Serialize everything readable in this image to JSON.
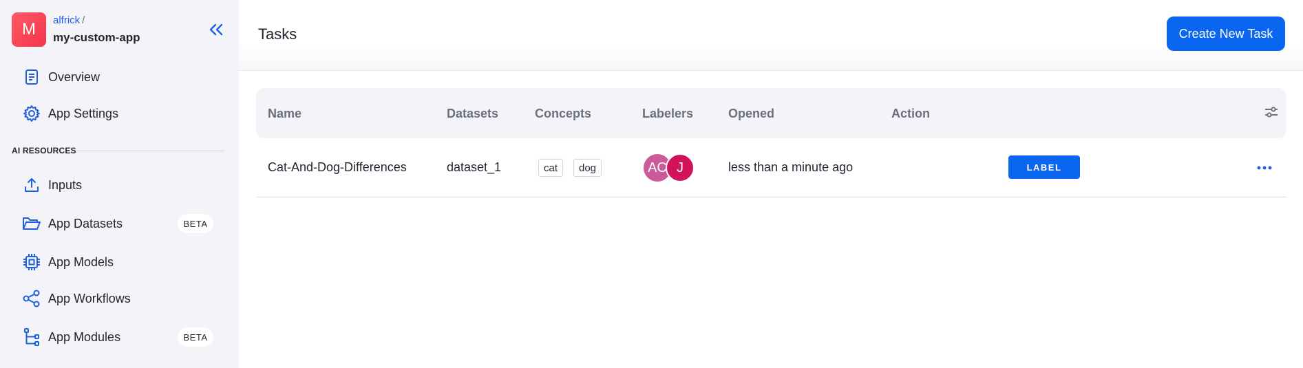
{
  "sidebar": {
    "app_avatar_letter": "M",
    "owner": "alfrick",
    "separator": "/",
    "app_name": "my-custom-app",
    "collapse_icon": "double-chevron-left-icon",
    "section_label": "AI RESOURCES",
    "items": [
      {
        "label": "Overview",
        "icon": "document-icon"
      },
      {
        "label": "App Settings",
        "icon": "gear-icon"
      },
      {
        "label": "Inputs",
        "icon": "upload-icon"
      },
      {
        "label": "App Datasets",
        "icon": "folder-open-icon",
        "badge": "BETA"
      },
      {
        "label": "App Models",
        "icon": "chip-icon"
      },
      {
        "label": "App Workflows",
        "icon": "share-nodes-icon"
      },
      {
        "label": "App Modules",
        "icon": "tree-branch-icon",
        "badge": "BETA"
      }
    ]
  },
  "header": {
    "title": "Tasks",
    "create_button": "Create New Task"
  },
  "table": {
    "columns": [
      "Name",
      "Datasets",
      "Concepts",
      "Labelers",
      "Opened",
      "Action"
    ],
    "settings_icon": "sliders-icon",
    "rows": [
      {
        "name": "Cat-And-Dog-Differences",
        "dataset": "dataset_1",
        "concepts": [
          "cat",
          "dog"
        ],
        "labelers": [
          {
            "initials": "AC",
            "color": "#cc5a9a"
          },
          {
            "initials": "J",
            "color": "#d0135a"
          }
        ],
        "opened": "less than a minute ago",
        "action": "LABEL",
        "more_icon": "ellipsis-icon"
      }
    ]
  },
  "colors": {
    "accent": "#0a66f0",
    "link": "#1e5fe0",
    "sidebar_bg": "#f4f4f8",
    "avatar_gradient": [
      "#ff5a66",
      "#f2344a"
    ]
  }
}
